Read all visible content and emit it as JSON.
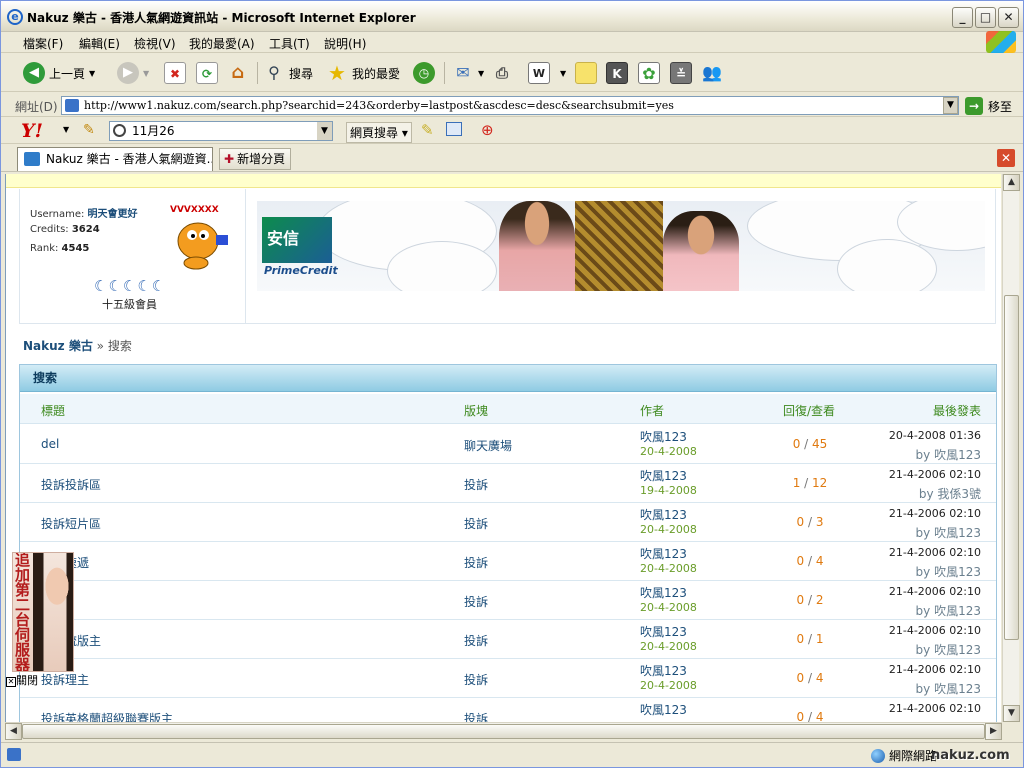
{
  "window": {
    "title": "Nakuz 樂古 - 香港人氣網遊資訊站 - Microsoft Internet Explorer"
  },
  "menu": [
    "檔案(F)",
    "編輯(E)",
    "檢視(V)",
    "我的最愛(A)",
    "工具(T)",
    "說明(H)"
  ],
  "toolbar": {
    "back_label": "上一頁",
    "search_label": "搜尋",
    "favorites_label": "我的最愛"
  },
  "address": {
    "label": "網址(D)",
    "url": "http://www1.nakuz.com/search.php?searchid=243&orderby=lastpost&ascdesc=desc&searchsubmit=yes",
    "go_label": "移至"
  },
  "yahoo": {
    "logo": "Y!",
    "search_value": "11月26",
    "web_search_label": "網頁搜尋"
  },
  "tabs": {
    "active_label": "Nakuz 樂古 - 香港人氣網遊資...",
    "new_tab_label": "新增分頁"
  },
  "profile": {
    "username_label": "Username:",
    "username": "明天會更好",
    "credits_label": "Credits:",
    "credits": "3624",
    "rank_label": "Rank:",
    "rank": "4545",
    "level_moons": "☾☾☾☾☾",
    "level_text": "十五級會員"
  },
  "banner": {
    "logo_text": "安信",
    "brand": "PrimeCredit"
  },
  "breadcrumb": {
    "home": "Nakuz 樂古",
    "sep": "»",
    "current": "搜索"
  },
  "search": {
    "header": "搜索",
    "columns": {
      "title": "標題",
      "forum": "版塊",
      "author": "作者",
      "stats": "回復/查看",
      "last": "最後發表"
    },
    "rows": [
      {
        "title": "del",
        "forum": "聊天廣場",
        "author": "吹風123",
        "date": "20-4-2008",
        "replies": "0",
        "views": "45",
        "last_time": "20-4-2008 01:36",
        "last_by": "by 吹風123"
      },
      {
        "title": "投訴投訴區",
        "forum": "投訴",
        "author": "吹風123",
        "date": "19-4-2008",
        "replies": "1",
        "views": "12",
        "last_time": "21-4-2006 02:10",
        "last_by": "by 我係3號"
      },
      {
        "title": "投訴短片區",
        "forum": "投訴",
        "author": "吹風123",
        "date": "20-4-2008",
        "replies": "0",
        "views": "3",
        "last_time": "21-4-2006 02:10",
        "last_by": "by 吹風123"
      },
      {
        "title": "短片速遞",
        "forum": "投訴",
        "author": "吹風123",
        "date": "20-4-2008",
        "replies": "0",
        "views": "4",
        "last_time": "21-4-2006 02:10",
        "last_by": "by 吹風123"
      },
      {
        "title": "首頁",
        "forum": "投訴",
        "author": "吹風123",
        "date": "20-4-2008",
        "replies": "0",
        "views": "2",
        "last_time": "21-4-2006 02:10",
        "last_by": "by 吹風123"
      },
      {
        "title": "教交流版主",
        "forum": "投訴",
        "author": "吹風123",
        "date": "20-4-2008",
        "replies": "0",
        "views": "1",
        "last_time": "21-4-2006 02:10",
        "last_by": "by 吹風123"
      },
      {
        "title": "投訴理主",
        "forum": "投訴",
        "author": "吹風123",
        "date": "20-4-2008",
        "replies": "0",
        "views": "4",
        "last_time": "21-4-2006 02:10",
        "last_by": "by 吹風123"
      },
      {
        "title": "投訴英格蘭超級聯賽版主",
        "forum": "投訴",
        "author": "吹風123",
        "date": "",
        "replies": "0",
        "views": "4",
        "last_time": "21-4-2006 02:10",
        "last_by": ""
      }
    ]
  },
  "float_ad": {
    "text": "追加第二台伺服器",
    "close_label": "關閉"
  },
  "status": {
    "zone": "網際網路",
    "watermark": "nakuz.com"
  }
}
